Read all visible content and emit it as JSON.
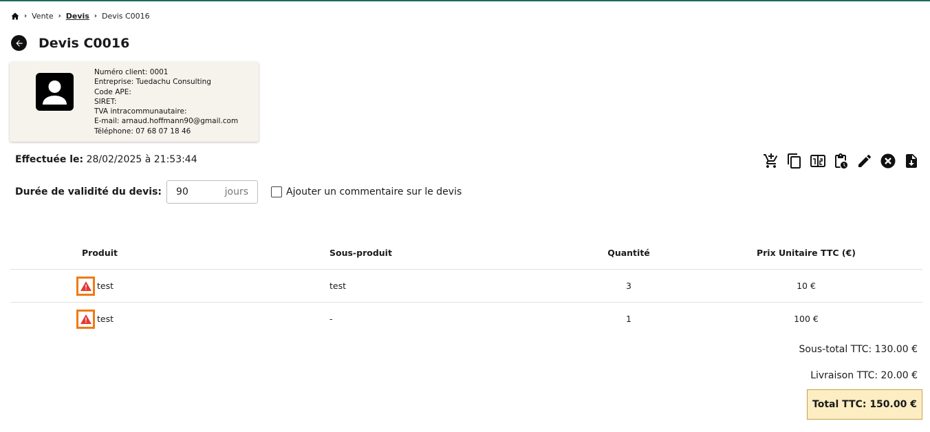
{
  "breadcrumb": {
    "item1": "Vente",
    "item2": "Devis",
    "item3": "Devis C0016"
  },
  "page": {
    "title": "Devis C0016"
  },
  "client": {
    "lines": [
      "Numéro client: 0001",
      "Entreprise: Tuedachu Consulting",
      "Code APE:",
      "SIRET:",
      "TVA intracommunautaire:",
      "E-mail: arnaud.hoffmann90@gmail.com",
      "Téléphone: 07 68 07 18 46"
    ]
  },
  "effectuee": {
    "label": "Effectuée le:",
    "value": "28/02/2025 à 21:53:44"
  },
  "toolbar_icons": [
    "cart-add-icon",
    "copy-icon",
    "invoice-icon",
    "clipboard-clock-icon",
    "edit-icon",
    "cancel-icon",
    "file-download-icon"
  ],
  "validity": {
    "label": "Durée de validité du devis:",
    "value": "90",
    "unit": "jours"
  },
  "comment": {
    "label": "Ajouter un commentaire sur le devis"
  },
  "table": {
    "headers": {
      "produit": "Produit",
      "sous_produit": "Sous-produit",
      "quantite": "Quantité",
      "prix": "Prix Unitaire TTC (€)"
    },
    "rows": [
      {
        "produit": "test",
        "sous_produit": "test",
        "quantite": "3",
        "prix": "10 €"
      },
      {
        "produit": "test",
        "sous_produit": "-",
        "quantite": "1",
        "prix": "100 €"
      }
    ]
  },
  "totals": {
    "subtotal": "Sous-total TTC: 130.00 €",
    "delivery": "Livraison TTC: 20.00 €",
    "total": "Total TTC: 150.00 €"
  },
  "colors": {
    "accent": "#f07a12",
    "warning": "#e53935",
    "card_bg": "#f6f3ec",
    "total_bg": "#fdedc2"
  }
}
